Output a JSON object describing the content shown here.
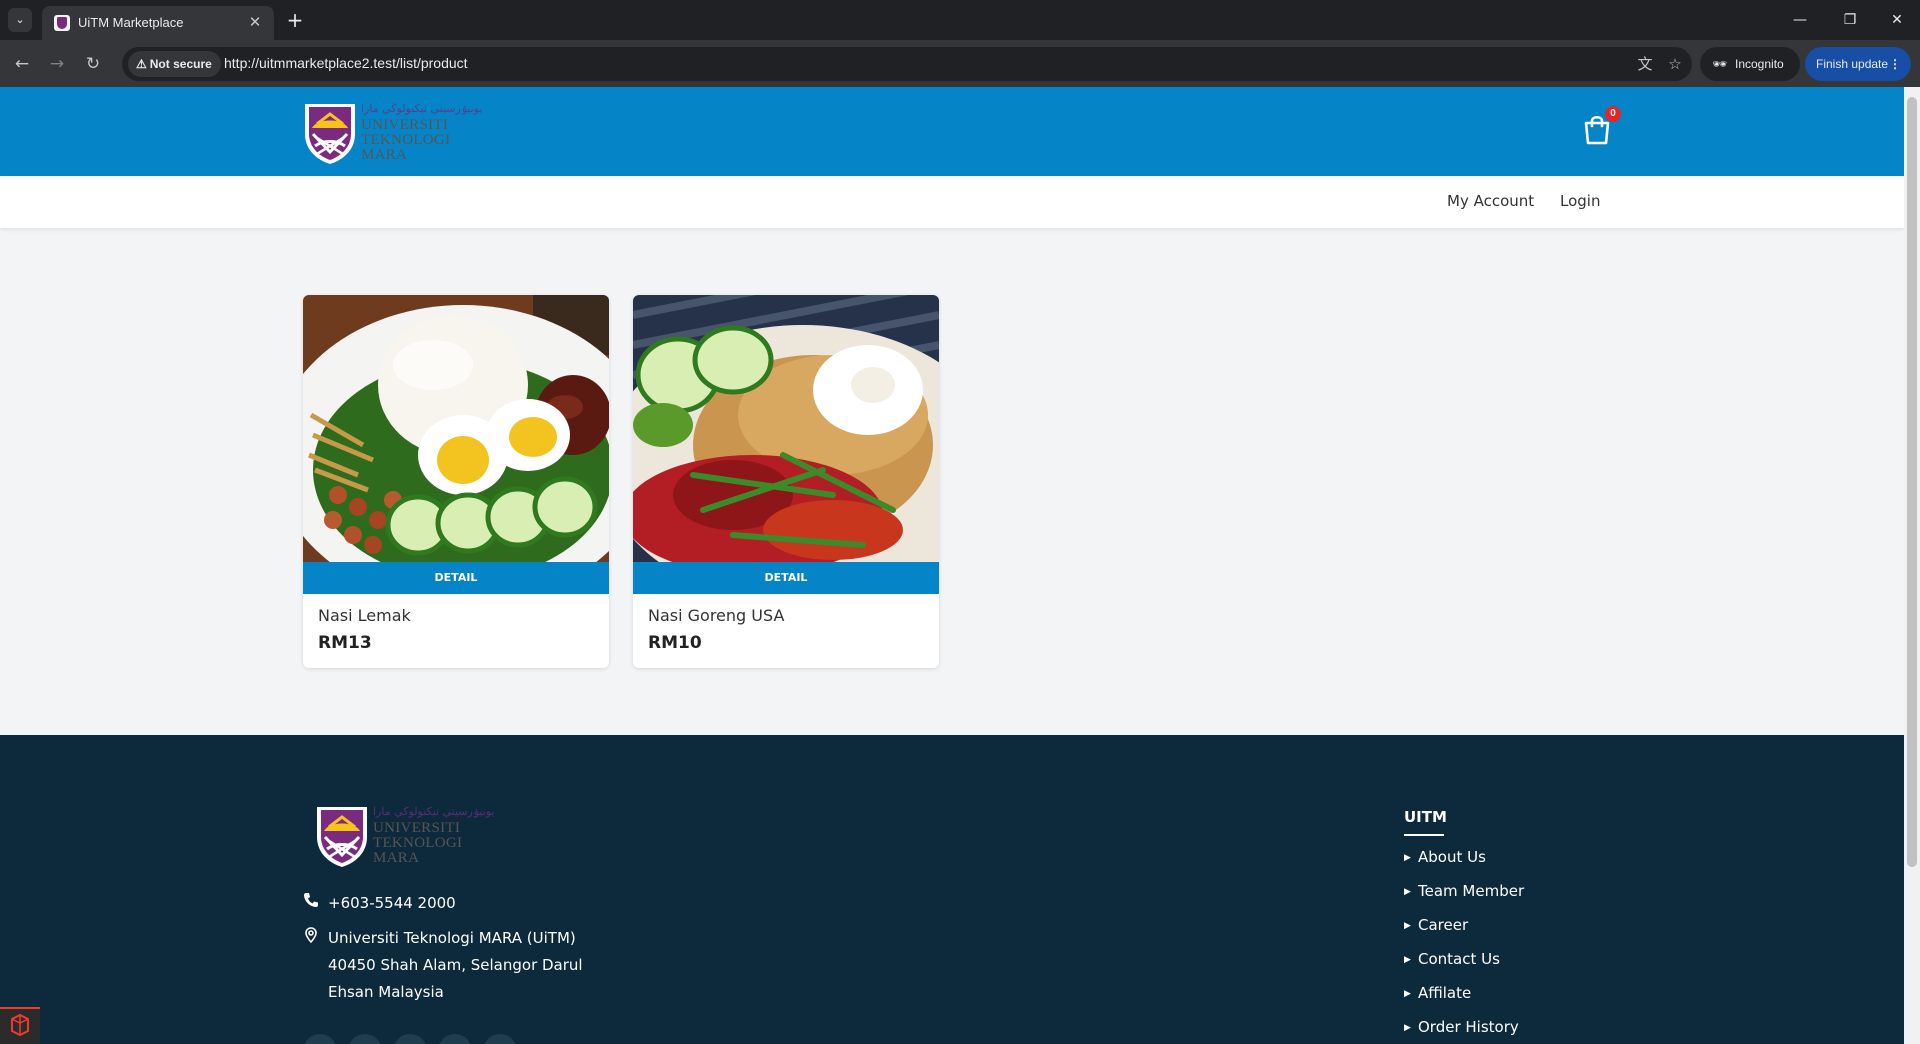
{
  "browser": {
    "tab_title": "UiTM Marketplace",
    "security_label": "Not secure",
    "url": "http://uitmmarketplace2.test/list/product",
    "incognito_label": "Incognito",
    "update_label": "Finish update"
  },
  "header": {
    "logo": {
      "jawi": "يونيۏرسيتي تيكنولوڬي مارا",
      "line1": "UNIVERSITI",
      "line2": "TEKNOLOGI",
      "line3": "MARA"
    },
    "cart_count": "0",
    "nav": {
      "my_account": "My Account",
      "login": "Login"
    }
  },
  "products": [
    {
      "name": "Nasi Lemak",
      "price": "RM13",
      "detail_label": "DETAIL"
    },
    {
      "name": "Nasi Goreng USA",
      "price": "RM10",
      "detail_label": "DETAIL"
    }
  ],
  "footer": {
    "phone": "+603-5544 2000",
    "address": [
      "Universiti Teknologi MARA (UiTM)",
      "40450 Shah Alam, Selangor Darul",
      "Ehsan Malaysia"
    ],
    "section_title": "UITM",
    "links": [
      "About Us",
      "Team Member",
      "Career",
      "Contact Us",
      "Affilate",
      "Order History"
    ]
  },
  "colors": {
    "brand_blue": "#0585c8",
    "footer_bg": "#0d2a3c",
    "badge_red": "#e5252a"
  }
}
